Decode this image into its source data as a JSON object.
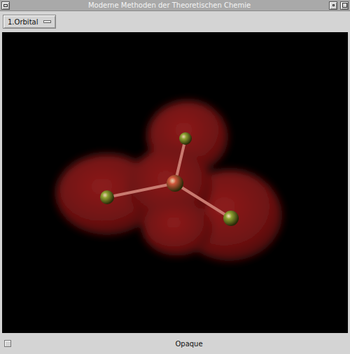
{
  "window": {
    "title": "Moderne Methoden der Theoretischen Chemie"
  },
  "orbital_menu": {
    "label": "1.Orbital"
  },
  "molecule": {
    "atoms": [
      {
        "kind": "central",
        "color": "#d0583c"
      },
      {
        "kind": "ligand",
        "color": "#8ea232"
      },
      {
        "kind": "ligand",
        "color": "#8ea232"
      },
      {
        "kind": "ligand",
        "color": "#8ea232"
      }
    ]
  },
  "opaque": {
    "label": "Opaque",
    "checked": false
  }
}
